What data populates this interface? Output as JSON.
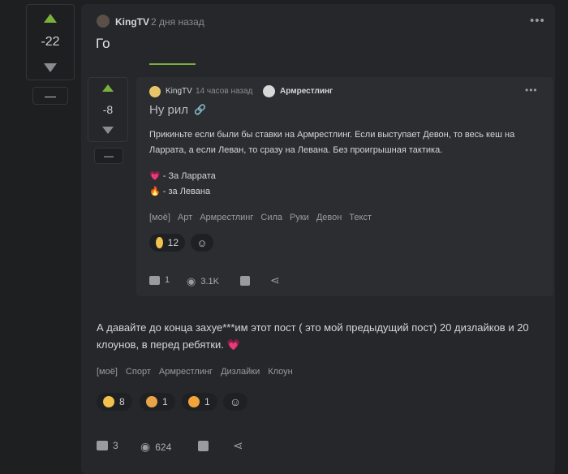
{
  "outer_vote": {
    "score": "-22",
    "minus": "—"
  },
  "post": {
    "author": "KingTV",
    "time": "2 дня назад",
    "title": "Го",
    "body": "А давайте до конца захуе***им этот пост ( это мой предыдущий пост) 20 дизлайков и 20 клоунов, в перед ребятки. ",
    "heart_emoji": "💗",
    "tags": [
      "[моё]",
      "Спорт",
      "Армрестлинг",
      "Дизлайки",
      "Клоун"
    ],
    "reactions": [
      {
        "icon": "clown-emoji-icon",
        "count": "8"
      },
      {
        "icon": "pensive-emoji-icon",
        "count": "1"
      },
      {
        "icon": "facepalm-emoji-icon",
        "count": "1"
      }
    ],
    "footer": {
      "comments": "3",
      "views": "624"
    }
  },
  "inner_vote": {
    "score": "-8",
    "minus": "—"
  },
  "inner_post": {
    "author": "KingTV",
    "time": "14 часов назад",
    "community": "Армрестлинг",
    "title": "Ну рил",
    "paragraph": "Прикиньте если были бы ставки на Армрестлинг. Если выступает Девон, то весь кеш на Ларрата, а если Леван, то сразу на Левана. Без проигрышная тактика.",
    "option1": "💗 - За Ларрата",
    "option2": "🔥 - за Левана",
    "tags": [
      "[моё]",
      "Арт",
      "Армрестлинг",
      "Сила",
      "Руки",
      "Девон",
      "Текст"
    ],
    "reaction": {
      "icon": "clown-emoji-icon",
      "count": "12"
    },
    "footer": {
      "comments": "1",
      "views": "3.1K"
    }
  },
  "colors": {
    "upvote": "#7ab03c",
    "accent_line": "#7ab03c",
    "heart": "#e8457a"
  }
}
